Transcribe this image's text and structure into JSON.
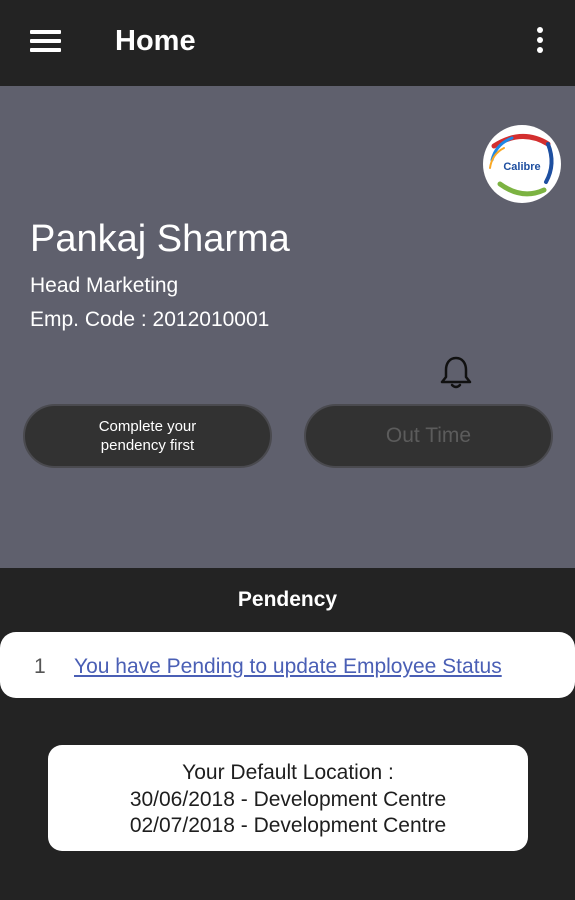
{
  "appbar": {
    "title": "Home",
    "menu_icon": "hamburger-menu-icon",
    "more_icon": "more-vertical-icon"
  },
  "profile": {
    "logo_text": "Calibre",
    "name": "Pankaj Sharma",
    "designation": "Head Marketing",
    "emp_code": "Emp. Code : 2012010001",
    "bell_icon": "bell-icon",
    "in_button_label": "Complete your pendency first",
    "out_button_label": "Out Time"
  },
  "pendency": {
    "title": "Pendency",
    "items": [
      {
        "index": "1",
        "text": "You have Pending to update Employee Status"
      }
    ]
  },
  "location": {
    "heading": "Your Default Location :",
    "lines": [
      "30/06/2018 - Development Centre",
      "02/07/2018 - Development Centre"
    ]
  },
  "colors": {
    "appbar_bg": "#232323",
    "profile_bg": "#5f606d",
    "link": "#4a5fb5"
  }
}
